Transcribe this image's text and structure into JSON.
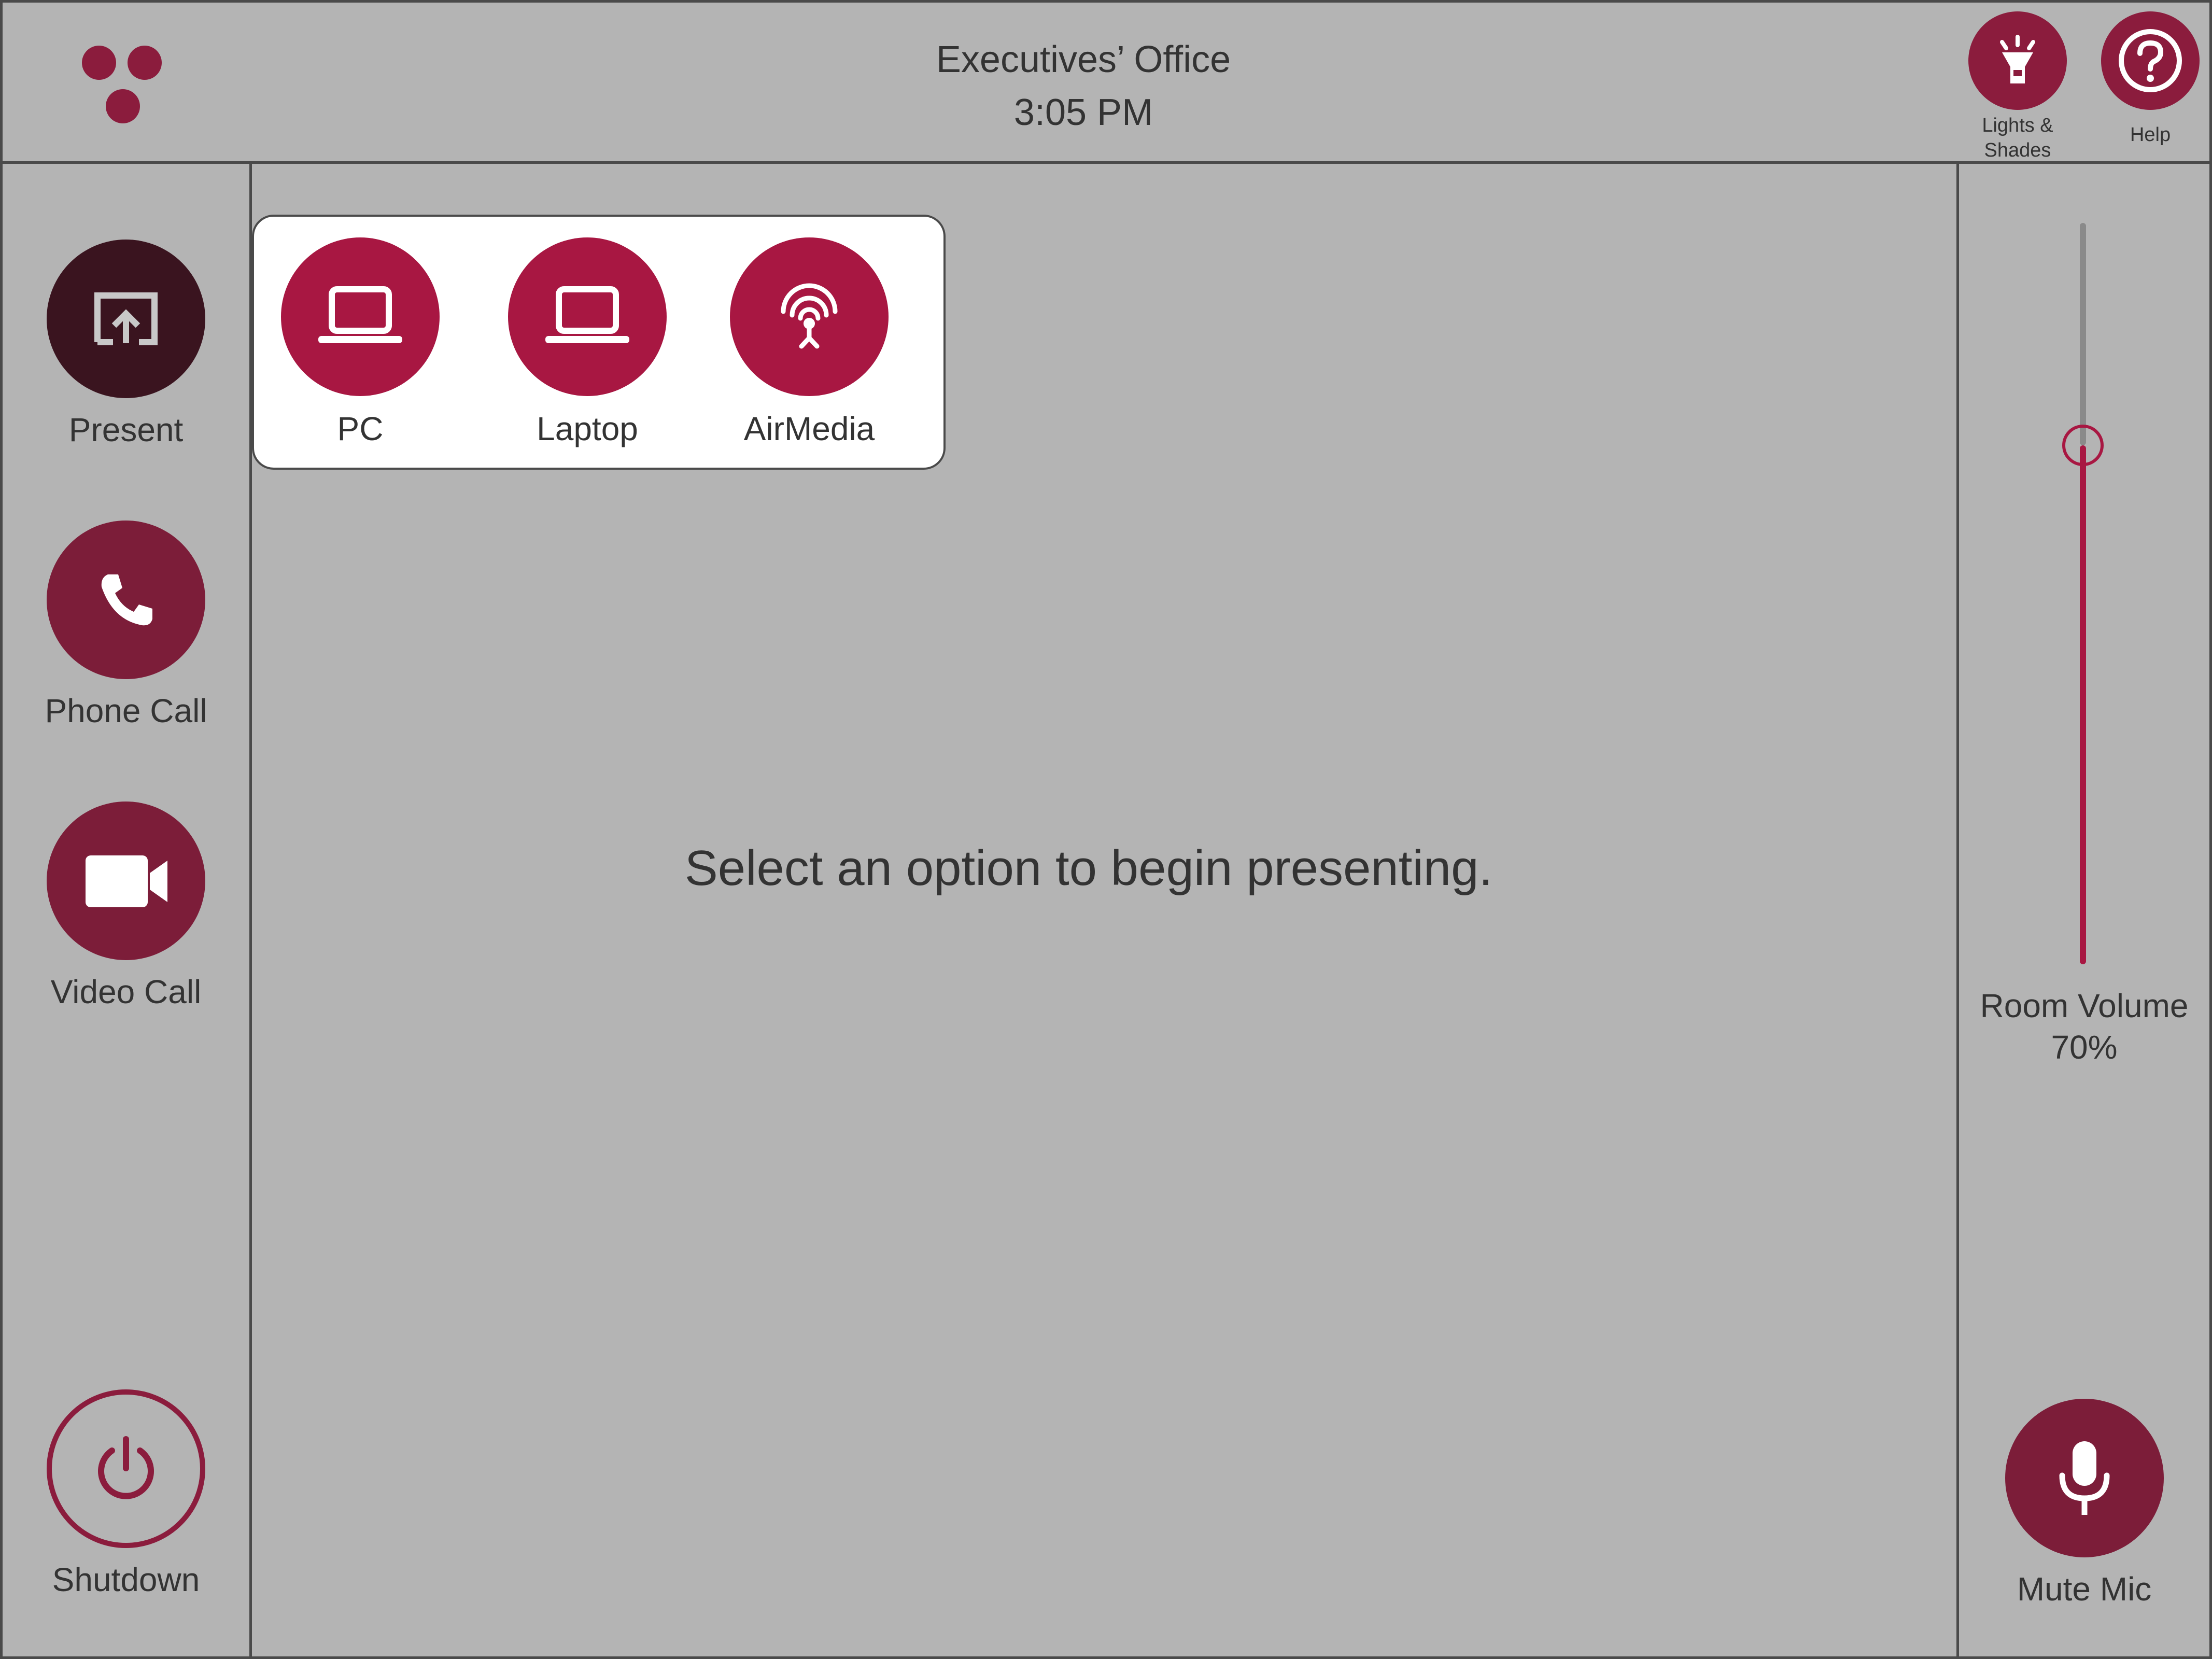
{
  "header": {
    "room_name": "Executives’ Office",
    "time": "3:05 PM",
    "lights_label": "Lights & Shades",
    "help_label": "Help"
  },
  "sidebar": {
    "present_label": "Present",
    "phone_label": "Phone Call",
    "video_label": "Video Call",
    "shutdown_label": "Shutdown"
  },
  "sources": {
    "items": [
      {
        "label": "PC",
        "icon": "laptop-icon"
      },
      {
        "label": "Laptop",
        "icon": "laptop-icon"
      },
      {
        "label": "AirMedia",
        "icon": "airmedia-icon"
      }
    ]
  },
  "main": {
    "prompt": "Select an option to begin presenting."
  },
  "volume": {
    "label": "Room Volume",
    "value_text": "70%",
    "level": 0.7
  },
  "mic": {
    "label": "Mute Mic"
  },
  "colors": {
    "accent": "#a81742",
    "dark_accent": "#7c1d39",
    "active": "#3a141f",
    "background": "#b4b4b4"
  }
}
